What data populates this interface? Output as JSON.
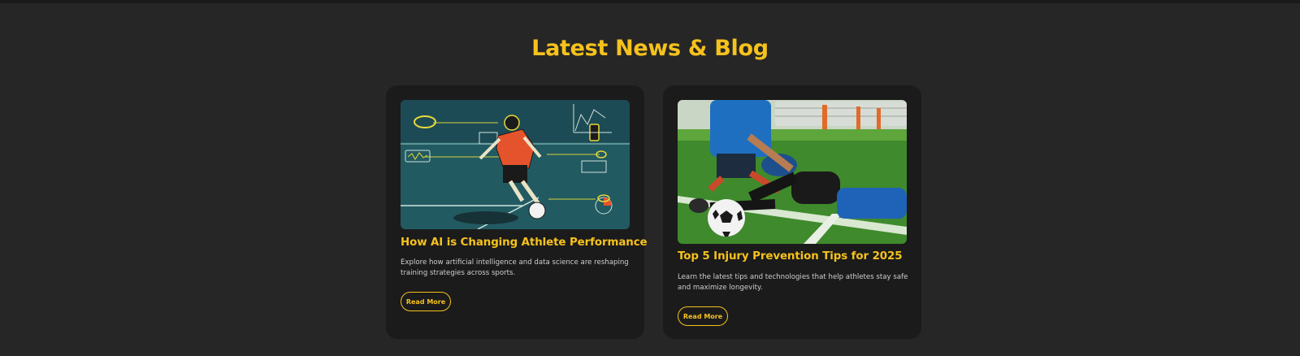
{
  "section": {
    "title": "Latest News & Blog"
  },
  "posts": [
    {
      "image": "ai-athlete-illustration",
      "title": "How AI is Changing Athlete Performance",
      "excerpt": "Explore how artificial intelligence and data science are reshaping training strategies across sports.",
      "button": "Read More"
    },
    {
      "image": "soccer-injury-photo",
      "title": "Top 5 Injury Prevention Tips for 2025",
      "excerpt": "Learn the latest tips and technologies that help athletes stay safe and maximize longevity.",
      "button": "Read More"
    }
  ],
  "colors": {
    "accent": "#f6c21c",
    "background": "#262626",
    "card": "#1b1b1b",
    "text": "#cfcfcf"
  }
}
